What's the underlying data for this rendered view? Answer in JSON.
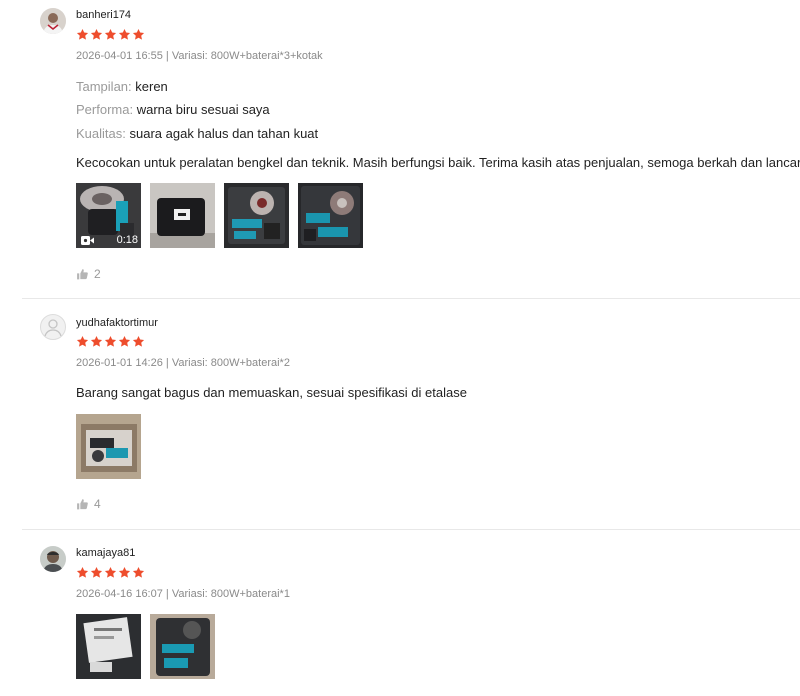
{
  "colors": {
    "star": "#ee4d2d",
    "meta": "#8a8a8a",
    "attr_key": "#9a9a9a"
  },
  "reviews": [
    {
      "username": "banheri174",
      "rating": 5,
      "date": "2026-04-01 16:55",
      "variation": "Variasi: 800W+baterai*3+kotak",
      "attributes": [
        {
          "key": "Tampilan:",
          "value": "keren"
        },
        {
          "key": "Performa:",
          "value": "warna biru sesuai saya"
        },
        {
          "key": "Kualitas:",
          "value": "suara agak halus dan tahan kuat"
        }
      ],
      "comment": "Kecocokan untuk peralatan bengkel dan teknik. Masih berfungsi baik. Terima kasih atas penjualan, semoga berkah dan lancar",
      "video_duration": "0:18",
      "likes": "2"
    },
    {
      "username": "yudhafaktortimur",
      "rating": 5,
      "date": "2026-01-01 14:26",
      "variation": "Variasi: 800W+baterai*2",
      "comment": "Barang sangat bagus dan memuaskan, sesuai spesifikasi di etalase",
      "likes": "4"
    },
    {
      "username": "kamajaya81",
      "rating": 5,
      "date": "2026-04-16 16:07",
      "variation": "Variasi: 800W+baterai*1"
    }
  ],
  "separator": " | "
}
